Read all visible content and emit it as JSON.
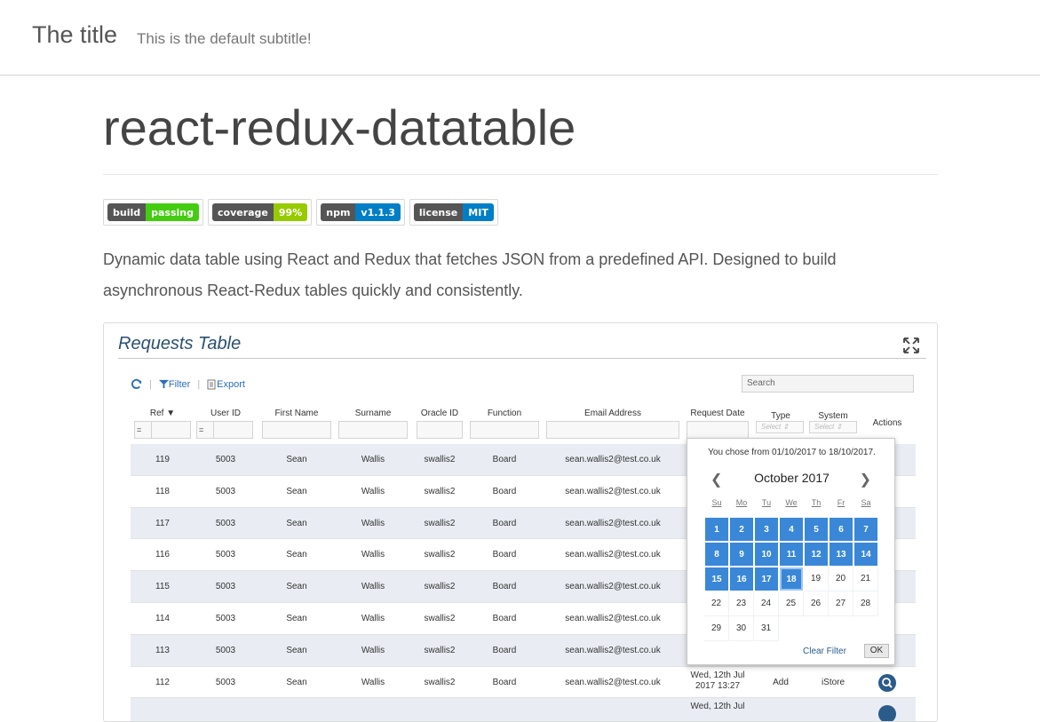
{
  "header": {
    "title": "The title",
    "subtitle": "This is the default subtitle!"
  },
  "page": {
    "heading": "react-redux-datatable",
    "description": "Dynamic data table using React and Redux that fetches JSON from a predefined API. Designed to build asynchronous React-Redux tables quickly and consistently."
  },
  "badges": [
    {
      "key": "build",
      "value": "passing",
      "color": "#4c1"
    },
    {
      "key": "coverage",
      "value": "99%",
      "color": "#97ca00"
    },
    {
      "key": "npm",
      "value": "v1.1.3",
      "color": "#007ec6"
    },
    {
      "key": "license",
      "value": "MIT",
      "color": "#007ec6"
    }
  ],
  "demo": {
    "title": "Requests Table",
    "toolbar": {
      "filter": "Filter",
      "export": "Export"
    },
    "search_placeholder": "Search",
    "columns": [
      "Ref",
      "User ID",
      "First Name",
      "Surname",
      "Oracle ID",
      "Function",
      "Email Address",
      "Request Date",
      "Type",
      "System",
      "Actions"
    ],
    "filter_ops": [
      "=",
      "="
    ],
    "select_placeholder": "Select",
    "rows": [
      {
        "ref": "119",
        "user": "5003",
        "first": "Sean",
        "surname": "Wallis",
        "oracle": "swallis2",
        "function": "Board",
        "email": "sean.wallis2@test.co.uk"
      },
      {
        "ref": "118",
        "user": "5003",
        "first": "Sean",
        "surname": "Wallis",
        "oracle": "swallis2",
        "function": "Board",
        "email": "sean.wallis2@test.co.uk"
      },
      {
        "ref": "117",
        "user": "5003",
        "first": "Sean",
        "surname": "Wallis",
        "oracle": "swallis2",
        "function": "Board",
        "email": "sean.wallis2@test.co.uk"
      },
      {
        "ref": "116",
        "user": "5003",
        "first": "Sean",
        "surname": "Wallis",
        "oracle": "swallis2",
        "function": "Board",
        "email": "sean.wallis2@test.co.uk"
      },
      {
        "ref": "115",
        "user": "5003",
        "first": "Sean",
        "surname": "Wallis",
        "oracle": "swallis2",
        "function": "Board",
        "email": "sean.wallis2@test.co.uk"
      },
      {
        "ref": "114",
        "user": "5003",
        "first": "Sean",
        "surname": "Wallis",
        "oracle": "swallis2",
        "function": "Board",
        "email": "sean.wallis2@test.co.uk"
      },
      {
        "ref": "113",
        "user": "5003",
        "first": "Sean",
        "surname": "Wallis",
        "oracle": "swallis2",
        "function": "Board",
        "email": "sean.wallis2@test.co.uk"
      },
      {
        "ref": "112",
        "user": "5003",
        "first": "Sean",
        "surname": "Wallis",
        "oracle": "swallis2",
        "function": "Board",
        "email": "sean.wallis2@test.co.uk",
        "date": "Wed, 12th Jul 2017 13:27",
        "type": "Add",
        "system": "iStore"
      },
      {
        "ref": "",
        "user": "",
        "first": "",
        "surname": "",
        "oracle": "",
        "function": "",
        "email": "",
        "date": "Wed, 12th Jul",
        "type": "",
        "system": ""
      }
    ],
    "datepicker": {
      "summary": "You chose from 01/10/2017 to 18/10/2017.",
      "month": "October 2017",
      "weekdays": [
        "Su",
        "Mo",
        "Tu",
        "We",
        "Th",
        "Fr",
        "Sa"
      ],
      "days": [
        "1",
        "2",
        "3",
        "4",
        "5",
        "6",
        "7",
        "8",
        "9",
        "10",
        "11",
        "12",
        "13",
        "14",
        "15",
        "16",
        "17",
        "18",
        "19",
        "20",
        "21",
        "22",
        "23",
        "24",
        "25",
        "26",
        "27",
        "28",
        "29",
        "30",
        "31"
      ],
      "range_start": 1,
      "range_end": 18,
      "clear_label": "Clear Filter",
      "ok_label": "OK"
    }
  }
}
